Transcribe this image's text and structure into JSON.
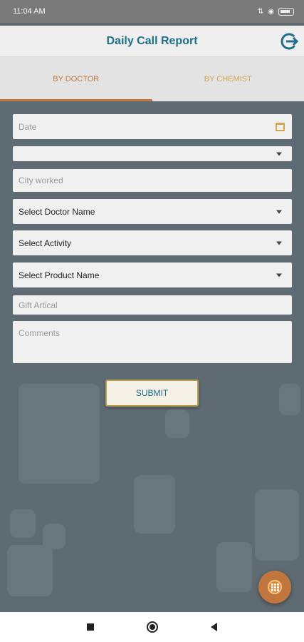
{
  "status_bar": {
    "time": "11:04 AM"
  },
  "app_bar": {
    "title": "Daily Call Report",
    "logout_icon": "logout-icon"
  },
  "tabs": [
    {
      "label": "BY DOCTOR",
      "active": true
    },
    {
      "label": "BY CHEMIST",
      "active": false
    }
  ],
  "form": {
    "date_placeholder": "Date",
    "city_placeholder": "City worked",
    "doctor_select": "Select Doctor Name",
    "activity_select": "Select Activity",
    "product_select": "Select Product Name",
    "gift_placeholder": "Gift Artical",
    "comments_placeholder": "Comments",
    "submit_label": "SUBMIT"
  },
  "colors": {
    "accent": "#1f6e8c",
    "tab_active": "#c0763d",
    "fab": "#c0763d"
  }
}
